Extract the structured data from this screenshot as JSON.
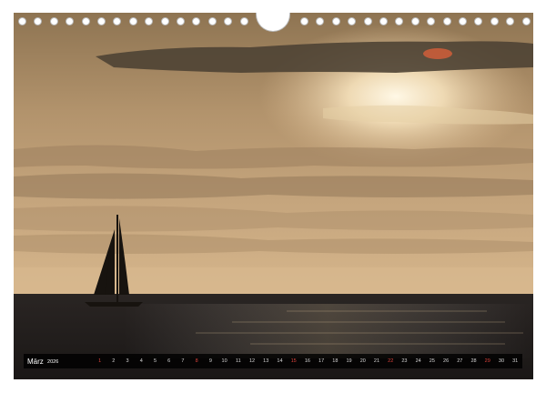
{
  "calendar": {
    "month": "März",
    "year": "2026",
    "days": [
      "1",
      "2",
      "3",
      "4",
      "5",
      "6",
      "7",
      "8",
      "9",
      "10",
      "11",
      "12",
      "13",
      "14",
      "15",
      "16",
      "17",
      "18",
      "19",
      "20",
      "21",
      "22",
      "23",
      "24",
      "25",
      "26",
      "27",
      "28",
      "29",
      "30",
      "31"
    ],
    "highlight_days": [
      "1",
      "8",
      "15",
      "22",
      "29"
    ]
  },
  "photo": {
    "subject": "sailboat-silhouette-sunset",
    "colors": {
      "sky_top": "#9a7b55",
      "sky_mid": "#c9a57a",
      "sky_horizon": "#d8b88e",
      "sun": "#fff6e0",
      "sea": "#2a2624",
      "highlight": "#e05030"
    }
  }
}
